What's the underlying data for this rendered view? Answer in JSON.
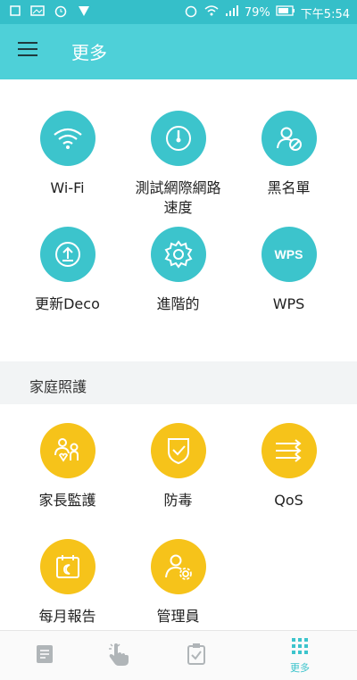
{
  "status": {
    "battery": "79%",
    "time": "下午5:54"
  },
  "app_bar": {
    "title": "更多"
  },
  "network_items": [
    {
      "label": "Wi-Fi"
    },
    {
      "label": "測試網際網路\n速度"
    },
    {
      "label": "黑名單"
    },
    {
      "label": "更新Deco"
    },
    {
      "label": "進階的"
    },
    {
      "label": "WPS"
    }
  ],
  "wps_icon_text": "WPS",
  "section": {
    "title": "家庭照護"
  },
  "care_items": [
    {
      "label": "家長監護"
    },
    {
      "label": "防毒"
    },
    {
      "label": "QoS"
    },
    {
      "label": "每月報告"
    },
    {
      "label": "管理員"
    }
  ],
  "bottom_nav": {
    "more_label": "更多"
  },
  "colors": {
    "teal": "#3cc4cc",
    "yellow": "#f6c31a",
    "app_bar": "#4ed0d8"
  }
}
